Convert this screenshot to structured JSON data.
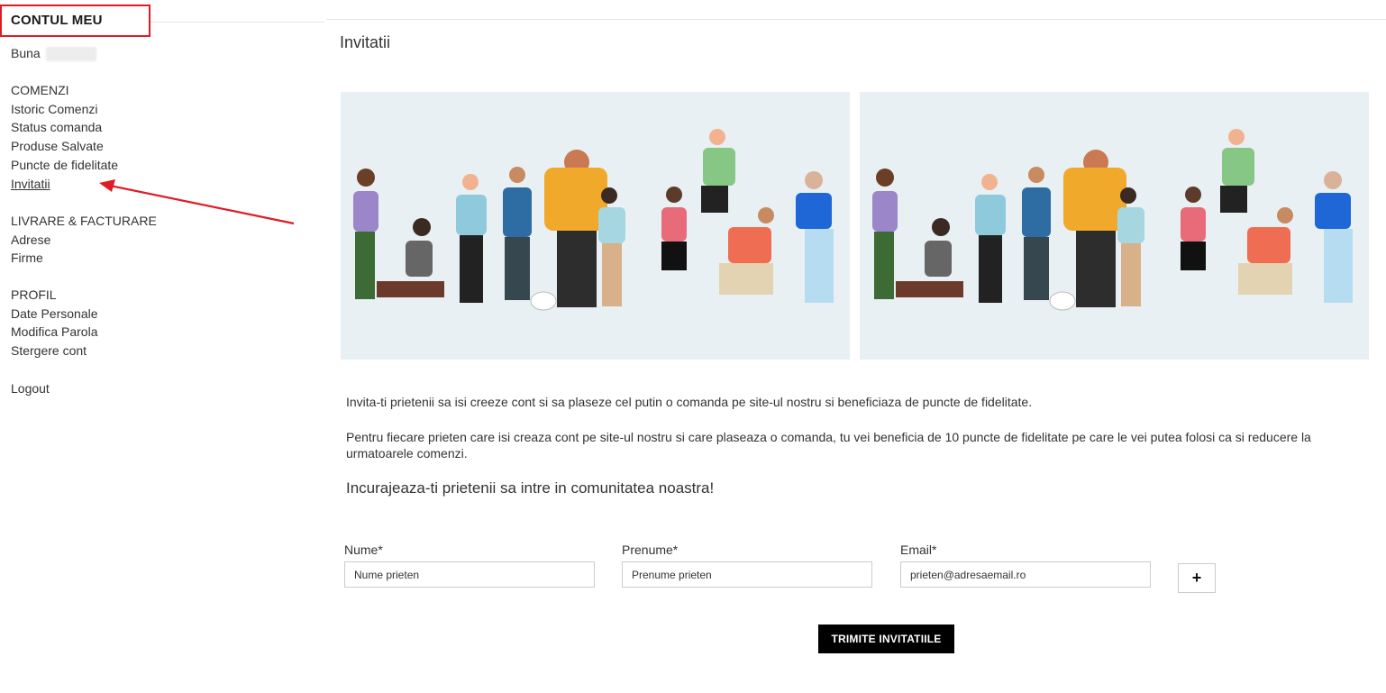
{
  "sidebar": {
    "title": "CONTUL MEU",
    "greeting": "Buna",
    "groups": [
      {
        "heading": "COMENZI",
        "links": [
          "Istoric Comenzi",
          "Status comanda",
          "Produse Salvate",
          "Puncte de fidelitate",
          "Invitatii"
        ]
      },
      {
        "heading": "LIVRARE & FACTURARE",
        "links": [
          "Adrese",
          "Firme"
        ]
      },
      {
        "heading": "PROFIL",
        "links": [
          "Date Personale",
          "Modifica Parola",
          "Stergere cont"
        ]
      }
    ],
    "logout": "Logout",
    "active_link": "Invitatii"
  },
  "main": {
    "title": "Invitatii",
    "intro": "Invita-ti prietenii sa isi creeze cont si sa plaseze cel putin o comanda pe site-ul nostru si beneficiaza de puncte de fidelitate.",
    "details": "Pentru fiecare prieten care isi creaza cont pe site-ul nostru si care plaseaza o comanda, tu vei beneficia de 10 puncte de fidelitate pe care le vei putea folosi ca si reducere la urmatoarele comenzi.",
    "encourage": "Incurajeaza-ti prietenii sa intre in comunitatea noastra!",
    "form": {
      "nume_label": "Nume*",
      "nume_placeholder": "Nume prieten",
      "prenume_label": "Prenume*",
      "prenume_placeholder": "Prenume prieten",
      "email_label": "Email*",
      "email_placeholder": "prieten@adresaemail.ro",
      "add_label": "+",
      "submit_label": "TRIMITE INVITATIILE"
    }
  },
  "colors": {
    "highlight": "#e01b24",
    "banner_bg": "#e8f0f3",
    "button_bg": "#000000"
  }
}
